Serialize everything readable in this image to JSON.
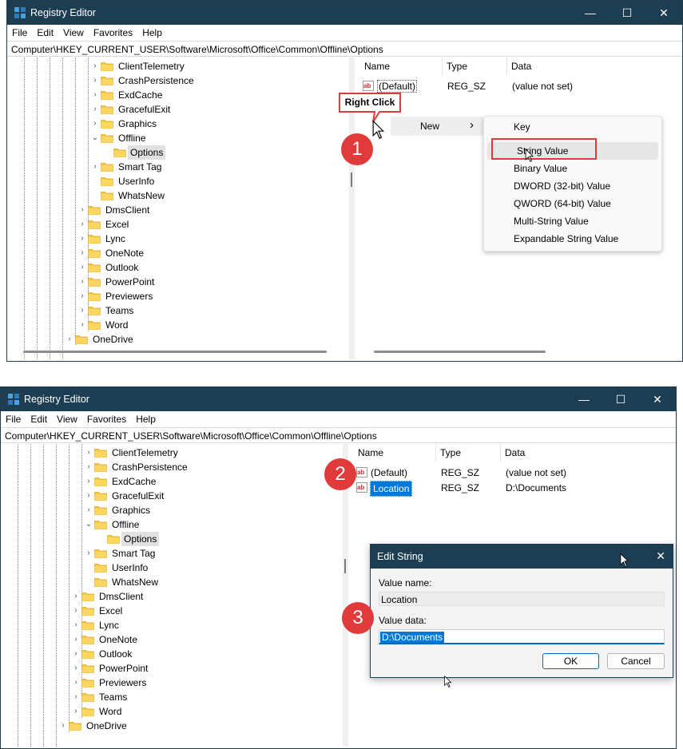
{
  "window": {
    "title": "Registry Editor",
    "controls": {
      "minimize": "—",
      "maximize": "☐",
      "close": "✕"
    },
    "menu": [
      "File",
      "Edit",
      "View",
      "Favorites",
      "Help"
    ],
    "address": "Computer\\HKEY_CURRENT_USER\\Software\\Microsoft\\Office\\Common\\Offline\\Options"
  },
  "tree": {
    "level3": [
      "ClientTelemetry",
      "CrashPersistence",
      "ExdCache",
      "GracefulExit",
      "Graphics",
      "Offline"
    ],
    "options": "Options",
    "level3b": [
      "Smart Tag",
      "UserInfo",
      "WhatsNew"
    ],
    "level2": [
      "DmsClient",
      "Excel",
      "Lync",
      "OneNote",
      "Outlook",
      "PowerPoint",
      "Previewers",
      "Teams",
      "Word"
    ],
    "onedrive": "OneDrive"
  },
  "columns": {
    "name": "Name",
    "type": "Type",
    "data": "Data"
  },
  "values_top": [
    {
      "name": "(Default)",
      "type": "REG_SZ",
      "data": "(value not set)"
    }
  ],
  "values_bottom": [
    {
      "name": "(Default)",
      "type": "REG_SZ",
      "data": "(value not set)"
    },
    {
      "name": "Location",
      "type": "REG_SZ",
      "data": "D:\\Documents"
    }
  ],
  "callout": "Right Click",
  "context_menu": {
    "new_label": "New",
    "arrow": "›",
    "items": [
      "Key",
      "String Value",
      "Binary Value",
      "DWORD (32-bit) Value",
      "QWORD (64-bit) Value",
      "Multi-String Value",
      "Expandable String Value"
    ]
  },
  "steps": [
    "1",
    "2",
    "3"
  ],
  "dialog": {
    "title": "Edit String",
    "close": "✕",
    "value_name_label": "Value name:",
    "value_name": "Location",
    "value_data_label": "Value data:",
    "value_data": "D:\\Documents",
    "ok": "OK",
    "cancel": "Cancel"
  },
  "colors": {
    "titlebar": "#1d3e52",
    "badge": "#e03a3a",
    "highlight": "#0078d7",
    "folder": "#f7c948"
  }
}
